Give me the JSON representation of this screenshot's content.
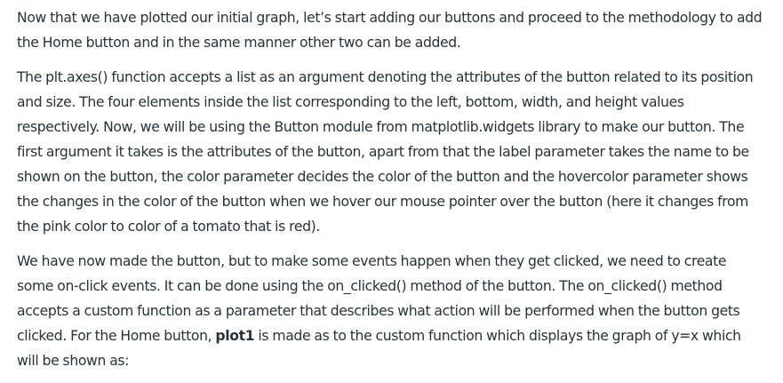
{
  "article": {
    "paragraphs": [
      {
        "text": "Now that we have plotted our initial graph, let’s start adding our buttons and proceed to the methodology to add the Home button and in the same manner other two can be added."
      },
      {
        "text": "The plt.axes() function accepts a list as an argument denoting the attributes of the button related to its position and size. The four elements inside the list corresponding to the left, bottom, width, and height values respectively.  Now, we will be using the Button module from matplotlib.widgets library to make our button. The first argument it takes is the attributes of the button, apart from that the label parameter takes the name to be shown on the button, the color parameter decides the color of the button and the hovercolor parameter shows the changes in the color of the button when we hover our mouse pointer over the button (here it changes from the pink color to color of a tomato that is red)."
      },
      {
        "text_before": "We have now made the button, but to make some events happen when they get clicked, we need to create some on-click events. It can be done using the on_clicked() method of the button. The on_clicked() method accepts a custom function as a parameter that describes what action will be performed when the button gets clicked.  For the Home button, ",
        "bold": "plot1",
        "text_after": " is made as to the custom function which displays the graph of y=x which will be shown as:"
      }
    ]
  }
}
